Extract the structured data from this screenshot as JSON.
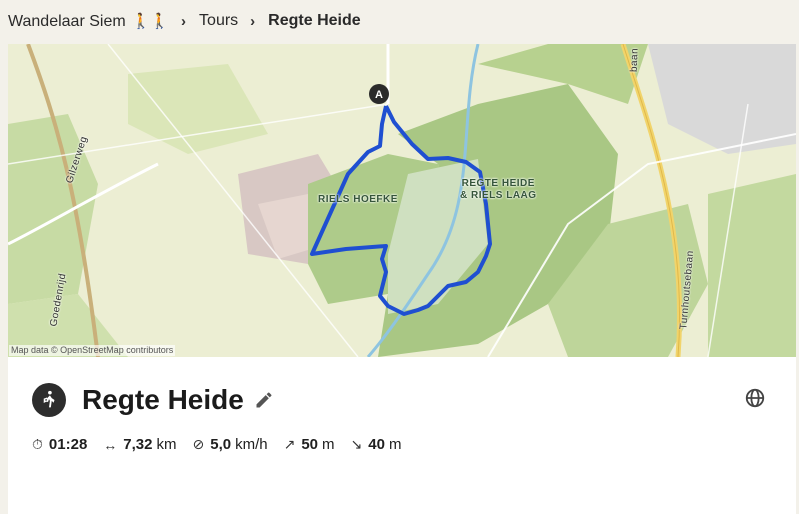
{
  "breadcrumb": {
    "home": "Wandelaar Siem",
    "home_icons": "🚶🚶",
    "section": "Tours",
    "current": "Regte Heide"
  },
  "map": {
    "attribution": "Map data © OpenStreetMap contributors",
    "start_marker": "A",
    "labels": {
      "area1": "RIELS HOEFKE",
      "area2_line1": "REGTE HEIDE",
      "area2_line2": "& RIELS LAAG",
      "road1": "Gilzerweg",
      "road2": "Goedenrijd",
      "road3": "Turnhoutsebaan",
      "road4": "baan"
    },
    "route_color": "#1f4fd1"
  },
  "tour": {
    "title": "Regte Heide",
    "activity_icon": "walking-icon",
    "stats": {
      "duration": "01:28",
      "distance_value": "7,32",
      "distance_unit": "km",
      "speed_value": "5,0",
      "speed_unit": "km/h",
      "ascent_value": "50",
      "ascent_unit": "m",
      "descent_value": "40",
      "descent_unit": "m"
    }
  }
}
